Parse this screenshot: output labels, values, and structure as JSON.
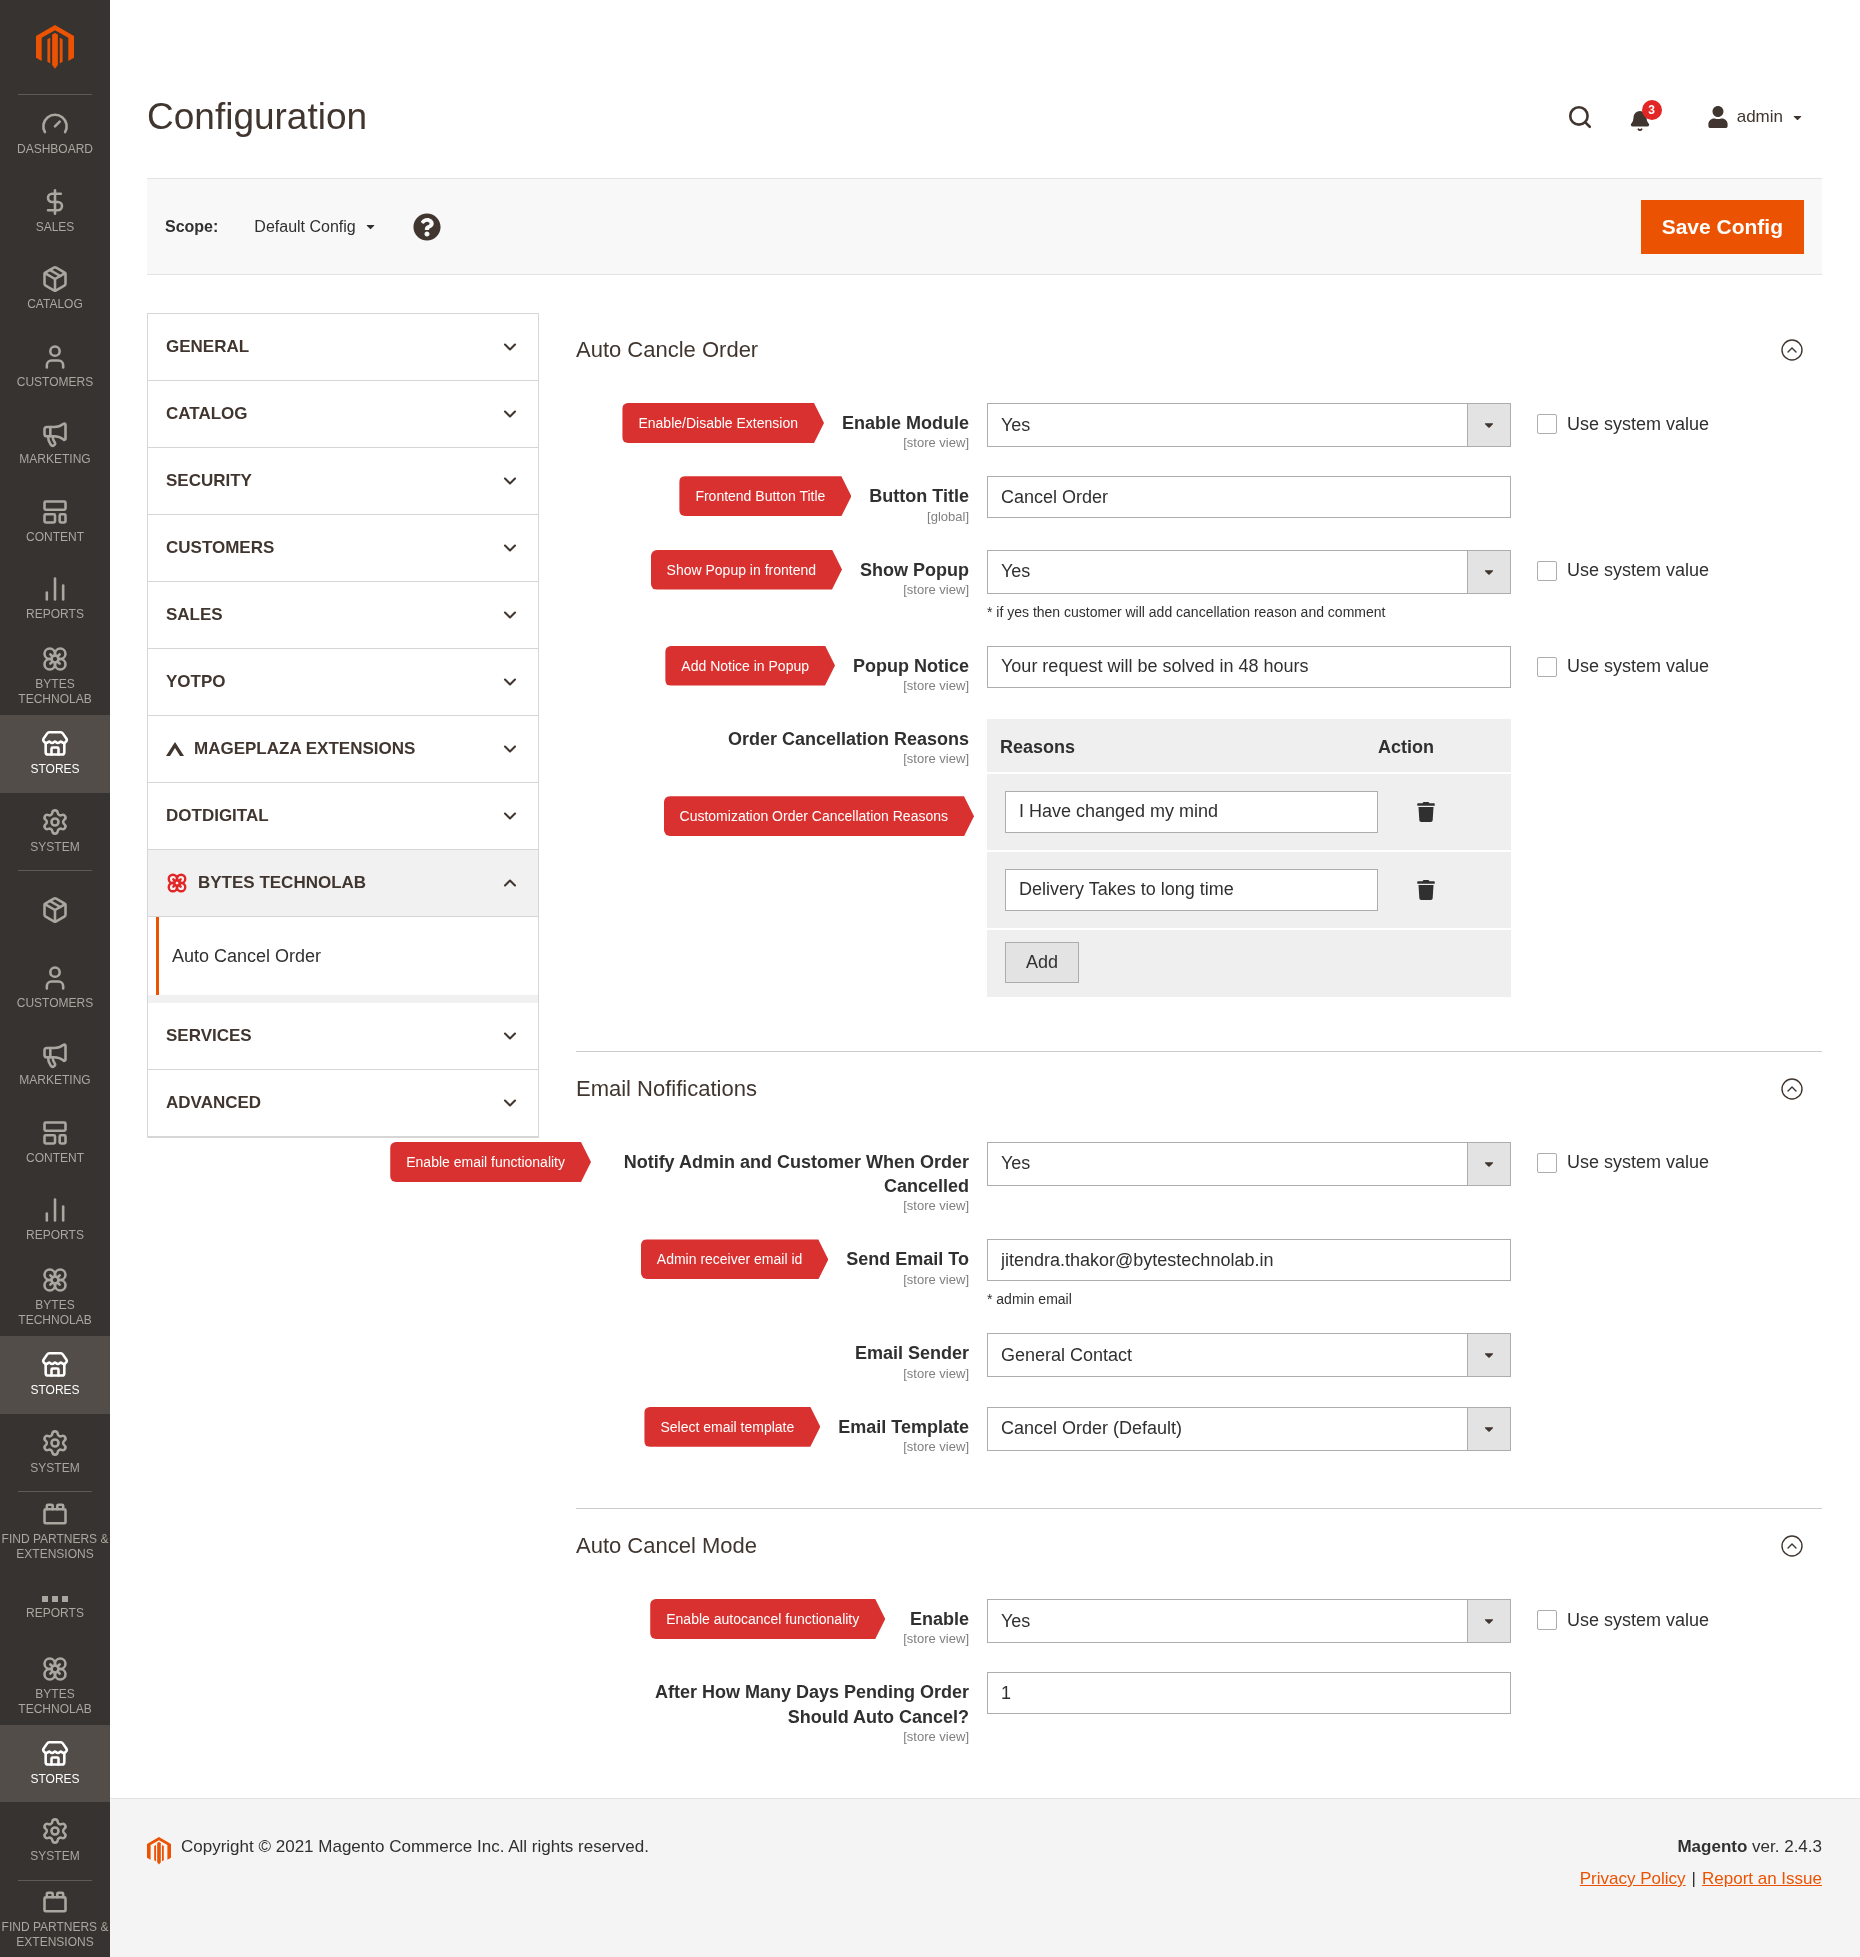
{
  "sidebar": {
    "items": [
      {
        "label": "DASHBOARD",
        "kind": "dashboard",
        "selected": false
      },
      {
        "label": "SALES",
        "kind": "sales",
        "selected": false
      },
      {
        "label": "CATALOG",
        "kind": "catalog",
        "selected": false
      },
      {
        "label": "CUSTOMERS",
        "kind": "customers",
        "selected": false
      },
      {
        "label": "MARKETING",
        "kind": "marketing",
        "selected": false
      },
      {
        "label": "CONTENT",
        "kind": "content",
        "selected": false
      },
      {
        "label": "REPORTS",
        "kind": "reports",
        "selected": false
      },
      {
        "label": "BYTES TECHNOLAB",
        "kind": "bytes",
        "selected": false
      },
      {
        "label": "STORES",
        "kind": "stores",
        "selected": true
      },
      {
        "label": "SYSTEM",
        "kind": "system",
        "selected": false,
        "divider_after": true
      },
      {
        "kind": "catalog",
        "selected": false
      },
      {
        "label": "CUSTOMERS",
        "kind": "customers",
        "selected": false
      },
      {
        "label": "MARKETING",
        "kind": "marketing",
        "selected": false
      },
      {
        "label": "CONTENT",
        "kind": "content",
        "selected": false
      },
      {
        "label": "REPORTS",
        "kind": "reports",
        "selected": false
      },
      {
        "label": "BYTES TECHNOLAB",
        "kind": "bytes",
        "selected": false
      },
      {
        "label": "STORES",
        "kind": "stores",
        "selected": true
      },
      {
        "label": "SYSTEM",
        "kind": "system",
        "selected": false,
        "divider_after": true
      },
      {
        "label": "FIND PARTNERS & EXTENSIONS",
        "kind": "partners",
        "selected": false
      },
      {
        "label": "REPORTS",
        "kind": "dots",
        "selected": false
      },
      {
        "label": "BYTES TECHNOLAB",
        "kind": "bytes",
        "selected": false
      },
      {
        "label": "STORES",
        "kind": "stores",
        "selected": true
      },
      {
        "label": "SYSTEM",
        "kind": "system",
        "selected": false,
        "divider_after": true
      },
      {
        "label": "FIND PARTNERS & EXTENSIONS",
        "kind": "partners",
        "selected": false
      }
    ]
  },
  "header": {
    "title": "Configuration",
    "notifications": "3",
    "user": "admin"
  },
  "scope": {
    "label": "Scope:",
    "value": "Default Config",
    "save_button": "Save Config"
  },
  "nav": [
    {
      "label": "GENERAL",
      "expanded": false
    },
    {
      "label": "CATALOG",
      "expanded": false
    },
    {
      "label": "SECURITY",
      "expanded": false
    },
    {
      "label": "CUSTOMERS",
      "expanded": false
    },
    {
      "label": "SALES",
      "expanded": false
    },
    {
      "label": "YOTPO",
      "expanded": false
    },
    {
      "label": "MAGEPLAZA EXTENSIONS",
      "expanded": false,
      "kind": "mageplaza"
    },
    {
      "label": "DOTDIGITAL",
      "expanded": false
    },
    {
      "label": "BYTES TECHNOLAB",
      "expanded": true,
      "kind": "bytes",
      "children": [
        {
          "label": "Auto Cancel Order",
          "selected": true
        }
      ]
    },
    {
      "label": "SERVICES",
      "expanded": false
    },
    {
      "label": "ADVANCED",
      "expanded": false
    }
  ],
  "sections": [
    {
      "title": "Auto Cancle Order",
      "expanded": true,
      "rows": [
        {
          "kind": "select",
          "callout": "Enable/Disable Extension",
          "label": "Enable Module",
          "scope": "[store view]",
          "value": "Yes",
          "use_system": {
            "label": "Use system value",
            "checked": false
          }
        },
        {
          "kind": "text",
          "callout": "Frontend Button Title",
          "label": "Button Title",
          "scope": "[global]",
          "value": "Cancel Order"
        },
        {
          "kind": "select",
          "callout": "Show Popup in frontend",
          "label": "Show Popup",
          "scope": "[store view]",
          "value": "Yes",
          "note": "* if yes then customer will add cancellation reason and comment",
          "use_system": {
            "label": "Use system value",
            "checked": false
          }
        },
        {
          "kind": "text",
          "callout": "Add Notice in Popup",
          "label": "Popup Notice",
          "scope": "[store view]",
          "value": "Your request will be solved in 48 hours",
          "use_system": {
            "label": "Use system value",
            "checked": false
          }
        },
        {
          "kind": "table",
          "label": "Order Cancellation Reasons",
          "scope": "[store view]",
          "callout": "Customization Order Cancellation Reasons",
          "columns": [
            "Reasons",
            "Action"
          ],
          "reasons": [
            "I Have changed my mind",
            "Delivery Takes to long time"
          ],
          "add_button": "Add"
        }
      ]
    },
    {
      "title": "Email Nofifications",
      "expanded": true,
      "rows": [
        {
          "kind": "select",
          "callout": "Enable email functionality",
          "label": "Notify Admin and Customer When Order Cancelled",
          "scope": "[store view]",
          "value": "Yes",
          "use_system": {
            "label": "Use system value",
            "checked": false
          }
        },
        {
          "kind": "text",
          "callout": "Admin receiver email id",
          "label": "Send Email To",
          "scope": "[store view]",
          "value": "jitendra.thakor@bytestechnolab.in",
          "note": "* admin email"
        },
        {
          "kind": "select",
          "label": "Email Sender",
          "scope": "[store view]",
          "value": "General Contact"
        },
        {
          "kind": "select",
          "callout": "Select email template",
          "label": "Email Template",
          "scope": "[store view]",
          "value": "Cancel Order (Default)"
        }
      ]
    },
    {
      "title": "Auto Cancel Mode",
      "expanded": true,
      "rows": [
        {
          "kind": "select",
          "callout": "Enable autocancel functionality",
          "label": "Enable",
          "scope": "[store view]",
          "value": "Yes",
          "use_system": {
            "label": "Use system value",
            "checked": false
          }
        },
        {
          "kind": "text",
          "label": "After How Many Days Pending Order Should Auto Cancel?",
          "scope": "[store view]",
          "value": "1"
        }
      ]
    }
  ],
  "footer": {
    "copyright": "Copyright © 2021 Magento Commerce Inc. All rights reserved.",
    "version": "**Magento** ver. 2.4.3",
    "links": [
      "Privacy Policy",
      "Report an Issue"
    ],
    "separator": "|"
  }
}
